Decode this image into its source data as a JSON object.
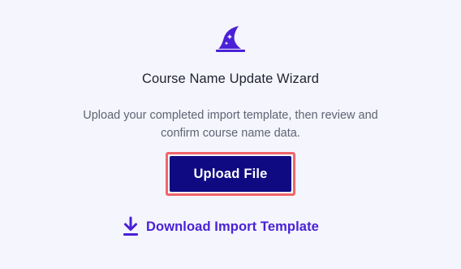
{
  "wizard": {
    "icon": "wizard-hat-icon",
    "title": "Course Name Update Wizard",
    "description": "Upload your completed import template, then review and confirm course name data.",
    "upload_label": "Upload File",
    "download_label": "Download Import Template",
    "download_icon": "download-icon"
  },
  "colors": {
    "background": "#f4f5fd",
    "primary_button": "#0f0a82",
    "focus_ring": "#f0656a",
    "accent": "#4a21d6",
    "title_text": "#1f2230",
    "body_text": "#5f6372"
  }
}
